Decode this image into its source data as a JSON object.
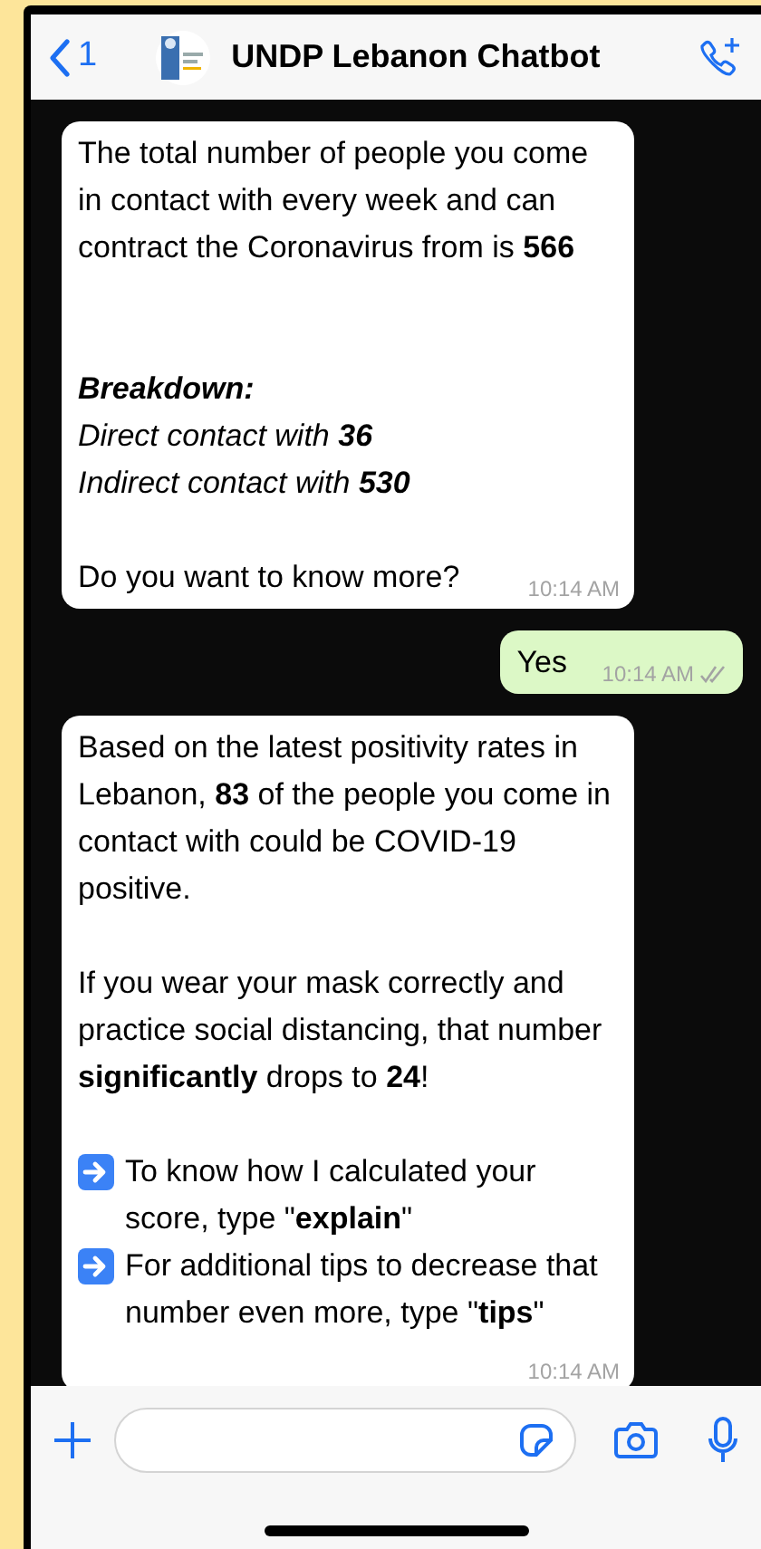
{
  "header": {
    "back_count": "1",
    "title": "UNDP Lebanon Chatbot"
  },
  "messages": [
    {
      "kind": "incoming",
      "time": "10:14 AM",
      "paragraphs": [
        [
          {
            "kind": "text",
            "text": "The total number of people you come in contact with every week and can contract the Coronavirus from is **566**"
          }
        ],
        [
          {
            "kind": "heading",
            "text": "Breakdown:"
          },
          {
            "kind": "italic",
            "text": "Direct contact with **36**"
          },
          {
            "kind": "italic",
            "text": "Indirect contact with **530**"
          }
        ],
        [
          {
            "kind": "text",
            "text": "Do you want to know more?"
          }
        ]
      ]
    },
    {
      "kind": "outgoing",
      "time": "10:14 AM",
      "read": false,
      "paragraphs": [
        [
          {
            "kind": "text",
            "text": "Yes"
          }
        ]
      ]
    },
    {
      "kind": "incoming",
      "time": "10:14 AM",
      "paragraphs": [
        [
          {
            "kind": "text",
            "text": "Based on the latest positivity rates in Lebanon, **83** of the people you come in contact with could be COVID-19 positive."
          }
        ],
        [
          {
            "kind": "text",
            "text": "If you wear your mask correctly and practice social distancing, that number **significantly** drops to **24**!"
          }
        ],
        [
          {
            "kind": "bullet",
            "text": "To know how I calculated your score, type \"**explain**\""
          },
          {
            "kind": "bullet",
            "text": "For additional tips to decrease that number even more, type \"**tips**\""
          }
        ]
      ]
    }
  ]
}
